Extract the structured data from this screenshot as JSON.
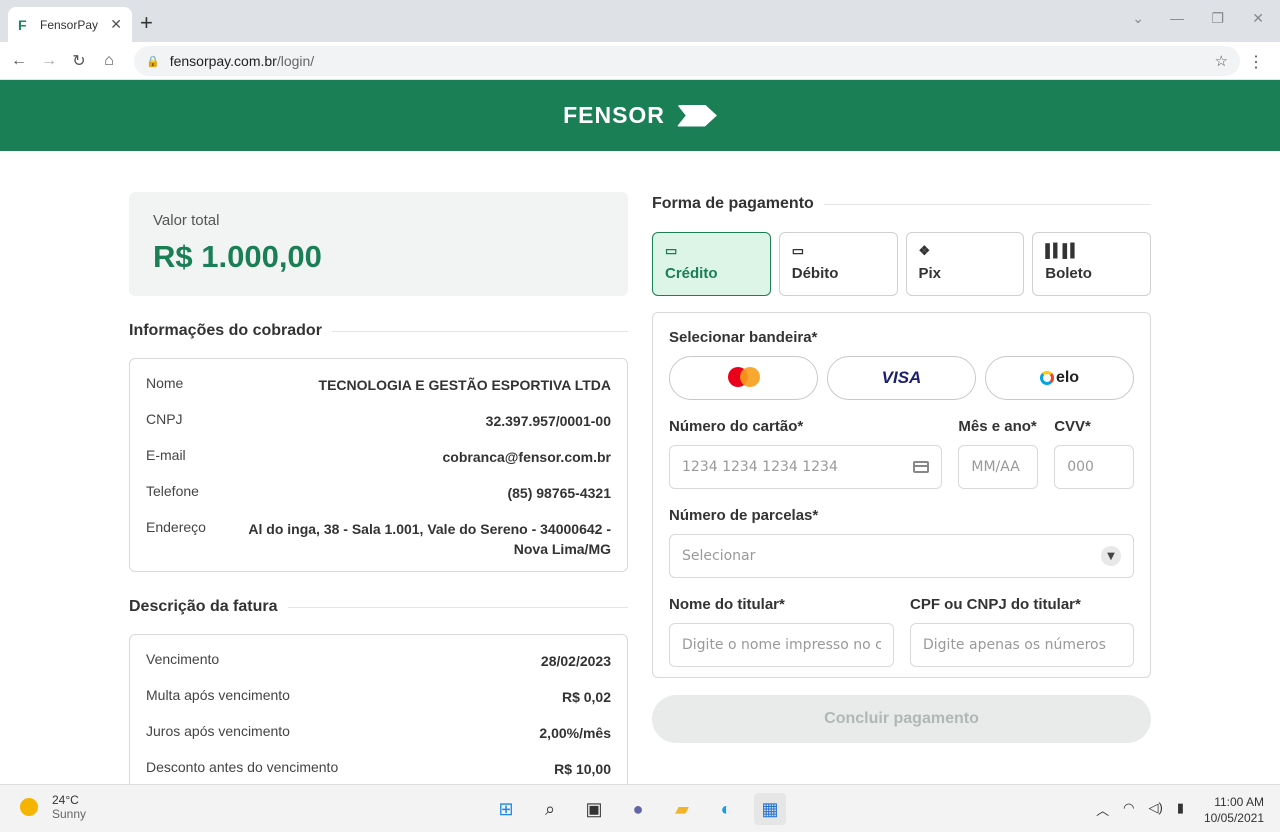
{
  "browser": {
    "tab_title": "FensorPay",
    "url_host": "fensorpay.com.br",
    "url_path": "/login/"
  },
  "header": {
    "logo_text": "FENSOR"
  },
  "total": {
    "label": "Valor total",
    "value": "R$ 1.000,00"
  },
  "collector": {
    "title": "Informações do cobrador",
    "rows": [
      {
        "key": "Nome",
        "value": "TECNOLOGIA E GESTÃO ESPORTIVA LTDA"
      },
      {
        "key": "CNPJ",
        "value": "32.397.957/0001-00"
      },
      {
        "key": "E-mail",
        "value": "cobranca@fensor.com.br"
      },
      {
        "key": "Telefone",
        "value": "(85) 98765-4321"
      },
      {
        "key": "Endereço",
        "value": "Al do inga, 38 - Sala 1.001, Vale do Sereno - 34000642 - Nova Lima/MG"
      }
    ]
  },
  "invoice": {
    "title": "Descrição da fatura",
    "rows": [
      {
        "key": "Vencimento",
        "value": "28/02/2023"
      },
      {
        "key": "Multa após vencimento",
        "value": "R$ 0,02"
      },
      {
        "key": "Juros após vencimento",
        "value": "2,00%/mês"
      },
      {
        "key": "Desconto antes do vencimento",
        "value": "R$ 10,00"
      }
    ]
  },
  "payment": {
    "title": "Forma de pagamento",
    "methods": [
      {
        "label": "Crédito",
        "icon": "credit-card-icon",
        "active": true
      },
      {
        "label": "Débito",
        "icon": "debit-card-icon",
        "active": false
      },
      {
        "label": "Pix",
        "icon": "pix-icon",
        "active": false
      },
      {
        "label": "Boleto",
        "icon": "barcode-icon",
        "active": false
      }
    ],
    "brand_label": "Selecionar bandeira*",
    "brands": [
      "mastercard",
      "VISA",
      "elo"
    ],
    "card_number_label": "Número do cartão*",
    "card_number_placeholder": "1234 1234 1234 1234",
    "expiry_label": "Mês e ano*",
    "expiry_placeholder": "MM/AA",
    "cvv_label": "CVV*",
    "cvv_placeholder": "000",
    "installments_label": "Número de parcelas*",
    "installments_value": "Selecionar",
    "holder_label": "Nome do titular*",
    "holder_placeholder": "Digite o nome impresso no c...",
    "doc_label": "CPF ou CNPJ do titular*",
    "doc_placeholder": "Digite apenas os números",
    "submit_label": "Concluir pagamento"
  },
  "taskbar": {
    "temperature": "24°C",
    "condition": "Sunny",
    "time": "11:00 AM",
    "date": "10/05/2021"
  },
  "colors": {
    "brand_green": "#1b7f55",
    "active_bg": "#dcf5e7"
  }
}
